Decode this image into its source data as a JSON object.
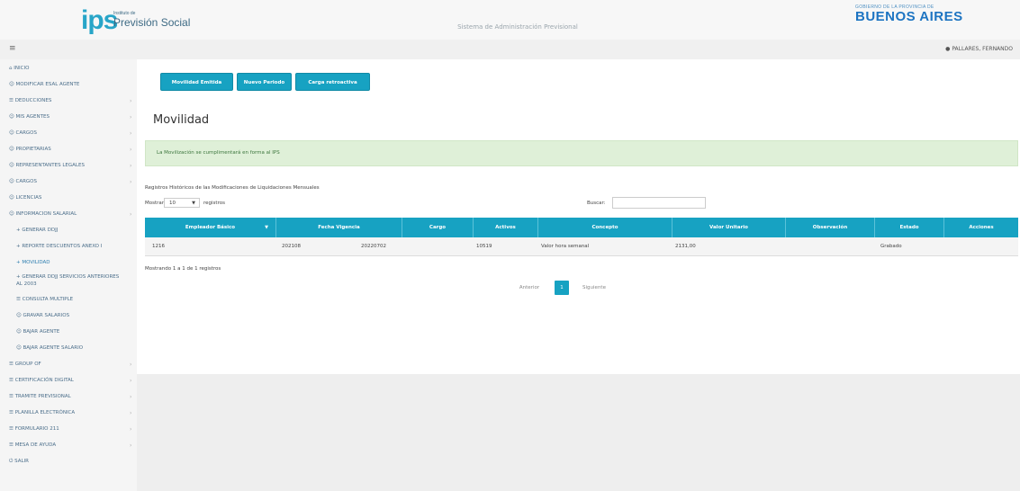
{
  "header": {
    "logo_mark": "ips",
    "logo_small": "Instituto de",
    "logo_text": "Previsión Social",
    "system_title": "Sistema de Administración Previsional",
    "gov_small": "GOBIERNO DE LA PROVINCIA DE",
    "gov_big": "BUENOS AIRES"
  },
  "topbar": {
    "menu_icon": "≡",
    "user_name": "PALLARES, FERNANDO"
  },
  "sidebar": {
    "items": [
      {
        "icon": "home-icon",
        "label": "INICIO",
        "chevron": false
      },
      {
        "icon": "user-icon",
        "label": "MODIFICAR ESAL AGENTE",
        "chevron": false
      },
      {
        "icon": "list-icon",
        "label": "DEDUCCIONES",
        "chevron": true
      },
      {
        "icon": "user-icon",
        "label": "MIS AGENTES",
        "chevron": true
      },
      {
        "icon": "user-icon",
        "label": "CARGOS",
        "chevron": true
      },
      {
        "icon": "user-icon",
        "label": "PROPIETARIAS",
        "chevron": true
      },
      {
        "icon": "user-icon",
        "label": "REPRESENTANTES LEGALES",
        "chevron": true
      },
      {
        "icon": "user-icon",
        "label": "CARGOS",
        "chevron": true
      },
      {
        "icon": "user-icon",
        "label": "LICENCIAS",
        "chevron": false
      },
      {
        "icon": "user-icon",
        "label": "INFORMACION SALARIAL",
        "chevron": true
      },
      {
        "icon": "plus-icon",
        "label": "GENERAR DDJJ",
        "chevron": false,
        "sub": true
      },
      {
        "icon": "plus-icon",
        "label": "REPORTE DESCUENTOS ANEXO I",
        "chevron": false,
        "sub": true
      },
      {
        "icon": "plus-icon",
        "label": "MOVILIDAD",
        "chevron": false,
        "sub": true,
        "active": true
      },
      {
        "icon": "plus-icon",
        "label": "GENERAR DDJJ SERVICIOS ANTERIORES AL 2003",
        "chevron": false,
        "sub": true,
        "multi": true
      },
      {
        "icon": "list-icon",
        "label": "CONSULTA MULTIPLE",
        "chevron": false,
        "sub": true
      },
      {
        "icon": "user-icon",
        "label": "GRAVAR SALARIOS",
        "chevron": false,
        "sub": true
      },
      {
        "icon": "user-icon",
        "label": "BAJAR AGENTE",
        "chevron": false,
        "sub": true
      },
      {
        "icon": "user-icon",
        "label": "BAJAR AGENTE SALARIO",
        "chevron": false,
        "sub": true
      },
      {
        "icon": "list-icon",
        "label": "GROUP OF",
        "chevron": true
      },
      {
        "icon": "list-icon",
        "label": "CERTIFICACIÓN DIGITAL",
        "chevron": true
      },
      {
        "icon": "list-icon",
        "label": "TRAMITE PREVISIONAL",
        "chevron": true
      },
      {
        "icon": "list-icon",
        "label": "PLANILLA ELECTRÓNICA",
        "chevron": true
      },
      {
        "icon": "list-icon",
        "label": "FORMULARIO 211",
        "chevron": true
      },
      {
        "icon": "list-icon",
        "label": "MESA DE AYUDA",
        "chevron": true
      },
      {
        "icon": "power-icon",
        "label": "SALIR",
        "chevron": false
      }
    ]
  },
  "toolbar": {
    "buttons": [
      "Movilidad Emitida",
      "Nuevo Periodo",
      "Carga retroactiva"
    ]
  },
  "page": {
    "title": "Movilidad",
    "alert": "La Movilización se cumplimentará en forma al IPS",
    "caption": "Registros Históricos de las Modificaciones de Liquidaciones Mensuales",
    "show_label": "Mostrar",
    "show_value": "10",
    "show_suffix": "registros",
    "search_label": "Buscar:",
    "search_value": ""
  },
  "table": {
    "columns": [
      "Empleador Básico",
      "Fecha Vigencia",
      "Cargo",
      "Activos",
      "Concepto",
      "Valor Unitario",
      "Observación",
      "Estado",
      "Acciones"
    ],
    "rows": [
      [
        "1216",
        "202108",
        "20220702",
        "10519",
        "Valor hora semanal",
        "2131,00",
        "",
        "Grabado",
        ""
      ]
    ],
    "info": "Mostrando 1 a 1 de 1 registros"
  },
  "pagination": {
    "prev": "Anterior",
    "current": "1",
    "next": "Siguiente"
  }
}
